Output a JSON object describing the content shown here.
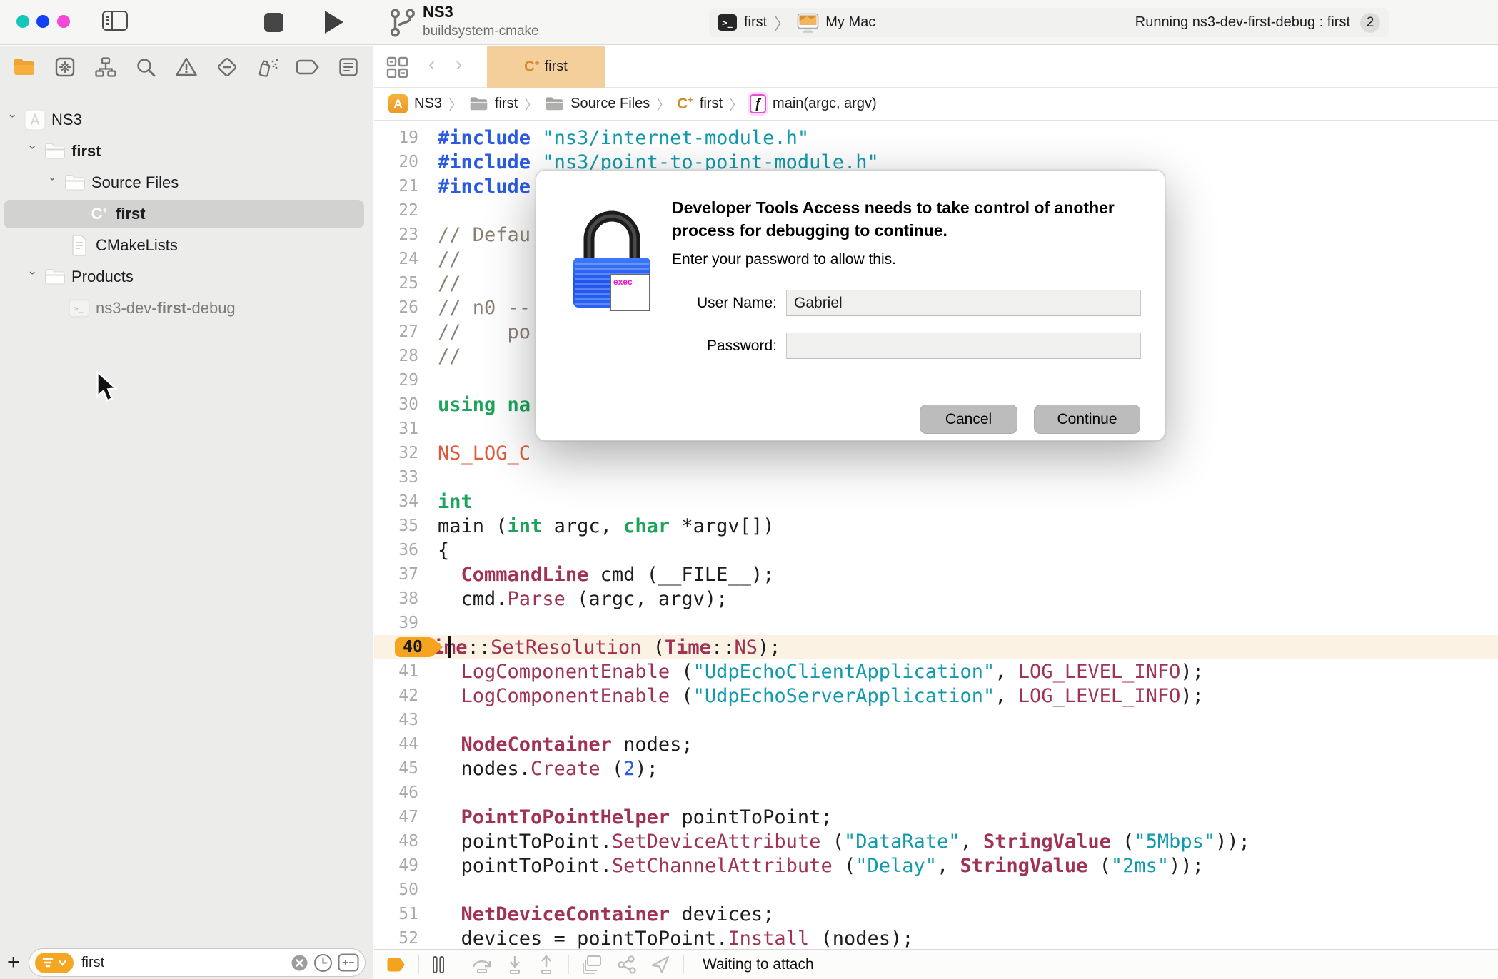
{
  "theme": {
    "accent_orange": "#f5a623",
    "tab_bg": "#f4cf9c",
    "current_line_bg": "#fbf2e3",
    "traffic_lights": [
      "#17c6ba",
      "#1240f2",
      "#f546d8"
    ],
    "syntax": {
      "include": "#2a5be2",
      "string": "#109aab",
      "keyword": "#1ea45a",
      "type": "#a03254",
      "function": "#a03254",
      "comment": "#8b8173",
      "macro": "#dd5b3b",
      "number": "#2a5be2"
    }
  },
  "toolbar": {
    "project_title": "NS3",
    "project_subtitle": "buildsystem-cmake",
    "scheme_name": "first",
    "run_destination": "My Mac",
    "activity_text": "Running ns3-dev-first-debug : first",
    "activity_badge": "2"
  },
  "navigator": {
    "icons": [
      "project-navigator",
      "source-control-navigator",
      "symbol-navigator",
      "find-navigator",
      "issue-navigator",
      "test-navigator",
      "debug-navigator",
      "breakpoint-navigator",
      "report-navigator"
    ],
    "active_icon": "project-navigator",
    "tree": [
      {
        "depth": 0,
        "chevron": true,
        "icon": "project",
        "segments": [
          {
            "t": "NS3"
          }
        ],
        "selected": false
      },
      {
        "depth": 1,
        "chevron": true,
        "icon": "folder",
        "segments": [
          {
            "t": "first",
            "b": true
          }
        ],
        "selected": false
      },
      {
        "depth": 2,
        "chevron": true,
        "icon": "folder",
        "segments": [
          {
            "t": "Source Files"
          }
        ],
        "selected": false
      },
      {
        "depth": 3,
        "chevron": false,
        "icon": "cpp",
        "segments": [
          {
            "t": "first",
            "b": true
          }
        ],
        "selected": true
      },
      {
        "depth": 2,
        "chevron": false,
        "icon": "doc",
        "segments": [
          {
            "t": "CMakeLists"
          }
        ],
        "selected": false
      },
      {
        "depth": 1,
        "chevron": true,
        "icon": "folder",
        "segments": [
          {
            "t": "Products"
          }
        ],
        "selected": false
      },
      {
        "depth": 2,
        "chevron": false,
        "icon": "terminal",
        "segments": [
          {
            "t": "ns3-dev-",
            "dim": true
          },
          {
            "t": "first",
            "b": true,
            "dim": true
          },
          {
            "t": "-debug",
            "dim": true
          }
        ],
        "selected": false
      }
    ],
    "filter": {
      "value": "first",
      "clear_icon": "x-circle",
      "recents_icon": "clock",
      "scope_icon": "plus-minus"
    }
  },
  "tabs": {
    "active": {
      "icon": "cpp",
      "label": "first"
    }
  },
  "breadcrumb": [
    {
      "icon": "app",
      "label": "NS3"
    },
    {
      "icon": "folder",
      "label": "first"
    },
    {
      "icon": "folder",
      "label": "Source Files"
    },
    {
      "icon": "cpp",
      "label": "first"
    },
    {
      "icon": "fn",
      "label": "main(argc, argv)"
    }
  ],
  "editor": {
    "current_line": 40,
    "breakpoint_badge": "40",
    "lines": [
      {
        "n": 19,
        "tk": [
          [
            "inc",
            "#include"
          ],
          [
            "p",
            " "
          ],
          [
            "str",
            "\"ns3/internet-module.h\""
          ]
        ]
      },
      {
        "n": 20,
        "tk": [
          [
            "inc",
            "#include"
          ],
          [
            "p",
            " "
          ],
          [
            "str",
            "\"ns3/point-to-point-module.h\""
          ]
        ]
      },
      {
        "n": 21,
        "tk": [
          [
            "inc",
            "#include"
          ]
        ]
      },
      {
        "n": 22,
        "tk": []
      },
      {
        "n": 23,
        "tk": [
          [
            "cmt",
            "// Defau"
          ]
        ]
      },
      {
        "n": 24,
        "tk": [
          [
            "cmt",
            "//"
          ]
        ]
      },
      {
        "n": 25,
        "tk": [
          [
            "cmt",
            "//"
          ]
        ]
      },
      {
        "n": 26,
        "tk": [
          [
            "cmt",
            "// n0 --"
          ]
        ]
      },
      {
        "n": 27,
        "tk": [
          [
            "cmt",
            "//    po"
          ]
        ]
      },
      {
        "n": 28,
        "tk": [
          [
            "cmt",
            "//"
          ]
        ]
      },
      {
        "n": 29,
        "tk": []
      },
      {
        "n": 30,
        "tk": [
          [
            "kw",
            "using"
          ],
          [
            "p",
            " "
          ],
          [
            "kw",
            "na"
          ]
        ]
      },
      {
        "n": 31,
        "tk": []
      },
      {
        "n": 32,
        "tk": [
          [
            "mac",
            "NS_LOG_C"
          ]
        ]
      },
      {
        "n": 33,
        "tk": []
      },
      {
        "n": 34,
        "tk": [
          [
            "kw",
            "int"
          ]
        ]
      },
      {
        "n": 35,
        "tk": [
          [
            "p",
            "main ("
          ],
          [
            "kw",
            "int"
          ],
          [
            "p",
            " argc, "
          ],
          [
            "kw",
            "char"
          ],
          [
            "p",
            " *argv[])"
          ]
        ]
      },
      {
        "n": 36,
        "tk": [
          [
            "p",
            "{"
          ]
        ]
      },
      {
        "n": 37,
        "tk": [
          [
            "p",
            "  "
          ],
          [
            "ty",
            "CommandLine"
          ],
          [
            "p",
            " cmd (__FILE__);"
          ]
        ]
      },
      {
        "n": 38,
        "tk": [
          [
            "p",
            "  cmd."
          ],
          [
            "fn",
            "Parse"
          ],
          [
            "p",
            " (argc, argv);"
          ]
        ]
      },
      {
        "n": 39,
        "tk": []
      },
      {
        "n": 40,
        "tk": [
          [
            "p",
            "  "
          ],
          [
            "ty",
            "Time"
          ],
          [
            "p",
            "::"
          ],
          [
            "fn",
            "SetResolution"
          ],
          [
            "p",
            " ("
          ],
          [
            "ty",
            "Time"
          ],
          [
            "p",
            "::"
          ],
          [
            "fn",
            "NS"
          ],
          [
            "p",
            ");"
          ]
        ]
      },
      {
        "n": 41,
        "tk": [
          [
            "p",
            "  "
          ],
          [
            "fn",
            "LogComponentEnable"
          ],
          [
            "p",
            " ("
          ],
          [
            "str",
            "\"UdpEchoClientApplication\""
          ],
          [
            "p",
            ", "
          ],
          [
            "fn",
            "LOG_LEVEL_INFO"
          ],
          [
            "p",
            ");"
          ]
        ]
      },
      {
        "n": 42,
        "tk": [
          [
            "p",
            "  "
          ],
          [
            "fn",
            "LogComponentEnable"
          ],
          [
            "p",
            " ("
          ],
          [
            "str",
            "\"UdpEchoServerApplication\""
          ],
          [
            "p",
            ", "
          ],
          [
            "fn",
            "LOG_LEVEL_INFO"
          ],
          [
            "p",
            ");"
          ]
        ]
      },
      {
        "n": 43,
        "tk": []
      },
      {
        "n": 44,
        "tk": [
          [
            "p",
            "  "
          ],
          [
            "ty",
            "NodeContainer"
          ],
          [
            "p",
            " nodes;"
          ]
        ]
      },
      {
        "n": 45,
        "tk": [
          [
            "p",
            "  nodes."
          ],
          [
            "fn",
            "Create"
          ],
          [
            "p",
            " ("
          ],
          [
            "num",
            "2"
          ],
          [
            "p",
            ");"
          ]
        ]
      },
      {
        "n": 46,
        "tk": []
      },
      {
        "n": 47,
        "tk": [
          [
            "p",
            "  "
          ],
          [
            "ty",
            "PointToPointHelper"
          ],
          [
            "p",
            " pointToPoint;"
          ]
        ]
      },
      {
        "n": 48,
        "tk": [
          [
            "p",
            "  pointToPoint."
          ],
          [
            "fn",
            "SetDeviceAttribute"
          ],
          [
            "p",
            " ("
          ],
          [
            "str",
            "\"DataRate\""
          ],
          [
            "p",
            ", "
          ],
          [
            "ty",
            "StringValue"
          ],
          [
            "p",
            " ("
          ],
          [
            "str",
            "\"5Mbps\""
          ],
          [
            "p",
            "));"
          ]
        ]
      },
      {
        "n": 49,
        "tk": [
          [
            "p",
            "  pointToPoint."
          ],
          [
            "fn",
            "SetChannelAttribute"
          ],
          [
            "p",
            " ("
          ],
          [
            "str",
            "\"Delay\""
          ],
          [
            "p",
            ", "
          ],
          [
            "ty",
            "StringValue"
          ],
          [
            "p",
            " ("
          ],
          [
            "str",
            "\"2ms\""
          ],
          [
            "p",
            "));"
          ]
        ]
      },
      {
        "n": 50,
        "tk": []
      },
      {
        "n": 51,
        "tk": [
          [
            "p",
            "  "
          ],
          [
            "ty",
            "NetDeviceContainer"
          ],
          [
            "p",
            " devices;"
          ]
        ]
      },
      {
        "n": 52,
        "tk": [
          [
            "p",
            "  devices = pointToPoint."
          ],
          [
            "fn",
            "Install"
          ],
          [
            "p",
            " (nodes);"
          ]
        ]
      }
    ]
  },
  "dialog": {
    "icon": "lock-exec",
    "lock_badge_text": "exec",
    "title": "Developer Tools Access needs to take control of another process for debugging to continue.",
    "subtitle": "Enter your password to allow this.",
    "username_label": "User Name:",
    "username_value": "Gabriel",
    "password_label": "Password:",
    "password_value": "",
    "cancel_label": "Cancel",
    "continue_label": "Continue"
  },
  "debug_bar": {
    "icons": [
      {
        "name": "breakpoints-toggle",
        "enabled": true
      },
      {
        "name": "sep"
      },
      {
        "name": "pause",
        "enabled": true
      },
      {
        "name": "sep"
      },
      {
        "name": "step-over",
        "enabled": false
      },
      {
        "name": "step-into",
        "enabled": false
      },
      {
        "name": "step-out",
        "enabled": false
      },
      {
        "name": "sep"
      },
      {
        "name": "view-hierarchy",
        "enabled": false
      },
      {
        "name": "memory-graph",
        "enabled": false
      },
      {
        "name": "simulate-location",
        "enabled": false
      },
      {
        "name": "sep"
      }
    ],
    "status_text": "Waiting to attach"
  }
}
